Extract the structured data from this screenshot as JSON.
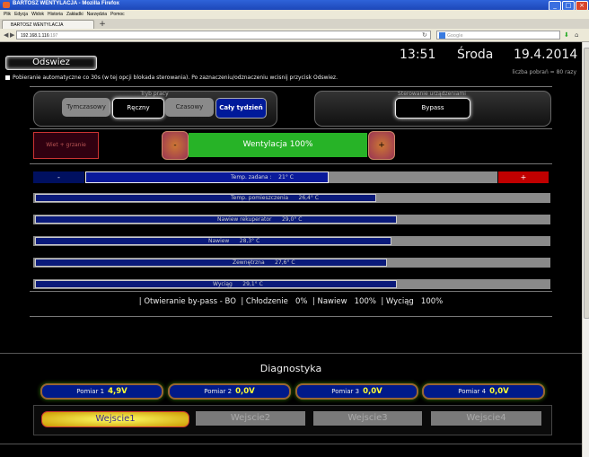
{
  "window": {
    "title": "BARTOSZ WENTYLACJA - Mozilla Firefox",
    "controls": [
      "_",
      "□",
      "×"
    ]
  },
  "menu": [
    "Plik",
    "Edycja",
    "Widok",
    "Historia",
    "Zakładki",
    "Narzędzia",
    "Pomoc"
  ],
  "tab": {
    "title": "BARTOSZ WENTYLACJA",
    "new_tab": "+"
  },
  "nav": {
    "url_main": "192.168.1.116",
    "url_rest": ":197",
    "search_placeholder": "Google"
  },
  "header": {
    "time": "13:51",
    "day": "Środa",
    "date": "19.4.2014",
    "refresh_label": "Odswiez",
    "count_text": "liczba pobrań = 80 razy",
    "auto_text": "Pobieranie automatyczne co 30s (w tej opcji blokada sterowania). Po zaznaczeniu/odznaczeniu wcisnij przycisk Odswiez."
  },
  "work_mode": {
    "title": "Tryb pracy",
    "modes": [
      "Tymczasowy",
      "Ręczny",
      "Czasowy",
      "Cały tydzień"
    ],
    "selected": "Ręczny",
    "active": "Cały tydzień"
  },
  "device_control": {
    "title": "Sterowanie urządzeniami",
    "bypass_label": "Bypass"
  },
  "fan": {
    "mode_label": "Wiet + grzanie",
    "minus": "-",
    "plus": "+",
    "label": "Wentylacja  100%",
    "percent": 100
  },
  "temp_target": {
    "minus": "-",
    "plus": "+",
    "label": "Temp. zadana :",
    "value": "21",
    "unit": "° C",
    "level": 0.59
  },
  "temperatures": [
    {
      "name": "Temp. pomieszczenia",
      "value": "26,4",
      "unit": "° C",
      "level": 0.66
    },
    {
      "name": "Nawiew rekuperator",
      "value": "29,0",
      "unit": "° C",
      "level": 0.7
    },
    {
      "name": "Nawiew",
      "value": "28,3",
      "unit": "° C",
      "level": 0.69
    },
    {
      "name": "Zewnętrzna",
      "value": "27,6",
      "unit": "° C",
      "level": 0.68
    },
    {
      "name": "Wyciąg",
      "value": "29,1",
      "unit": "° C",
      "level": 0.7
    }
  ],
  "status_line": "| Otwieranie by-pass - BO  | Chłodzenie   0%  | Nawiew   100%  | Wyciąg   100%",
  "diagnostics": {
    "title": "Diagnostyka",
    "measurements": [
      {
        "label": "Pomiar 1",
        "value": "4,9V"
      },
      {
        "label": "Pomiar 2",
        "value": "0,0V"
      },
      {
        "label": "Pomiar 3",
        "value": "0,0V"
      },
      {
        "label": "Pomiar 4",
        "value": "0,0V"
      }
    ],
    "inputs": [
      {
        "label": "Wejscie1",
        "active": true
      },
      {
        "label": "Wejscie2",
        "active": false
      },
      {
        "label": "Wejscie3",
        "active": false
      },
      {
        "label": "Wejscie4",
        "active": false
      }
    ]
  }
}
